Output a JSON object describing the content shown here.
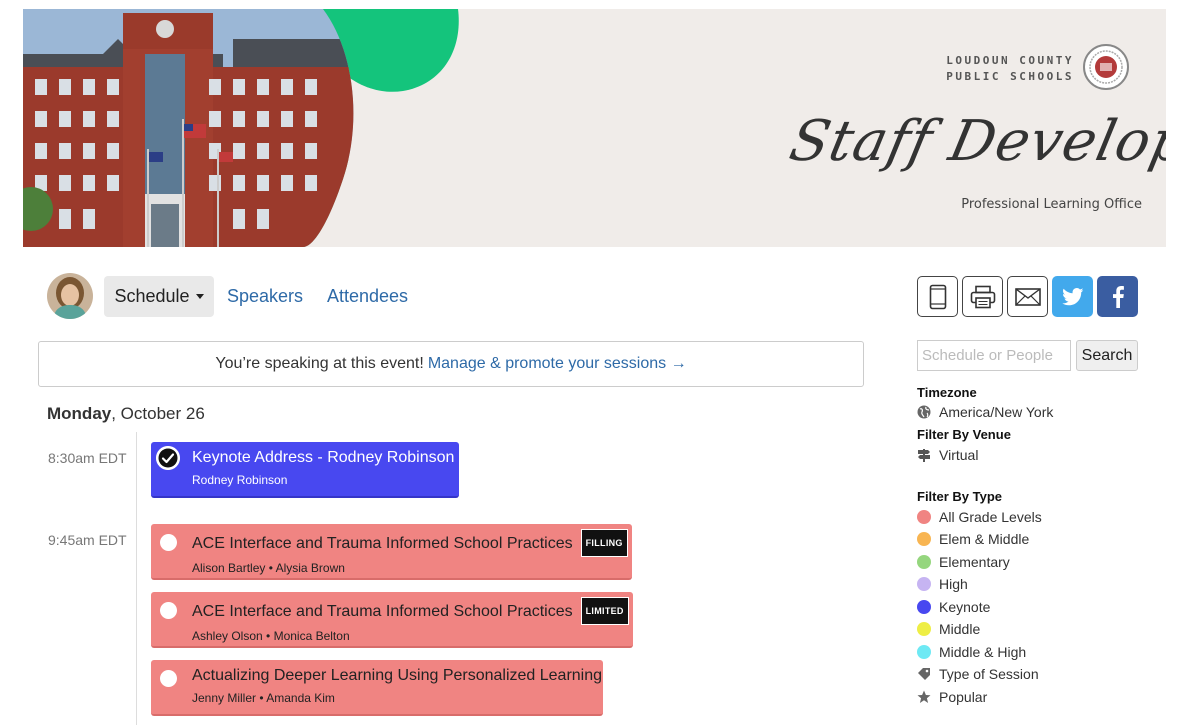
{
  "banner": {
    "org_line1": "LOUDOUN COUNTY",
    "org_line2": "PUBLIC SCHOOLS",
    "title": "Staff Development",
    "subtitle": "Professional Learning Office"
  },
  "nav": {
    "schedule": "Schedule",
    "speakers": "Speakers",
    "attendees": "Attendees"
  },
  "share": [
    "mobile-icon",
    "print-icon",
    "email-icon",
    "twitter-icon",
    "facebook-icon"
  ],
  "speaking_banner": {
    "text": "You’re speaking at this event!",
    "link": "Manage & promote your sessions →"
  },
  "day": {
    "weekday": "Monday",
    "date": ", October 26"
  },
  "times": [
    "8:30am EDT",
    "9:45am EDT"
  ],
  "sessions": [
    {
      "title": "Keynote Address - Rodney Robinson",
      "speakers": "Rodney Robinson",
      "badge": "",
      "type": "keynote",
      "color": "#4848f0"
    },
    {
      "title": "ACE Interface and Trauma Informed School Practices",
      "speakers": "Alison Bartley • Alysia Brown",
      "badge": "FILLING",
      "type": "all-grade",
      "color": "#f08482"
    },
    {
      "title": "ACE Interface and Trauma Informed School Practices",
      "speakers": "Ashley Olson • Monica Belton",
      "badge": "LIMITED",
      "type": "all-grade",
      "color": "#f08482"
    },
    {
      "title": "Actualizing Deeper Learning Using Personalized Learning",
      "speakers": "Jenny Miller • Amanda Kim",
      "badge": "",
      "type": "all-grade",
      "color": "#f08482"
    }
  ],
  "sidebar": {
    "search_placeholder": "Schedule or People",
    "search_button": "Search",
    "timezone_heading": "Timezone",
    "timezone_value": "America/New York",
    "venue_heading": "Filter By Venue",
    "venue_value": "Virtual",
    "type_heading": "Filter By Type",
    "types": [
      {
        "label": "All Grade Levels",
        "color": "#f08482"
      },
      {
        "label": "Elem & Middle",
        "color": "#f8b552"
      },
      {
        "label": "Elementary",
        "color": "#95d67e"
      },
      {
        "label": "High",
        "color": "#c6b4f2"
      },
      {
        "label": "Keynote",
        "color": "#4848f0"
      },
      {
        "label": "Middle",
        "color": "#eeee45"
      },
      {
        "label": "Middle & High",
        "color": "#6ee9f4"
      }
    ],
    "type_of_session": "Type of Session",
    "popular": "Popular"
  }
}
